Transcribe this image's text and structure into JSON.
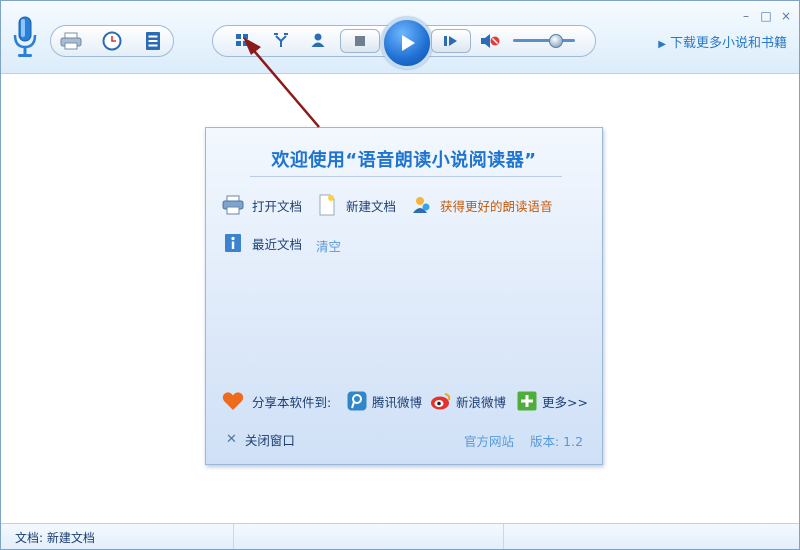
{
  "toolbar": {
    "download_label": "下载更多小说和书籍",
    "icons": [
      "microphone-icon",
      "printer-icon",
      "clock-icon",
      "document-list-icon",
      "grid-icon",
      "repeat-icon",
      "voice-person-icon",
      "stop-icon",
      "play-icon",
      "next-icon",
      "mute-icon"
    ],
    "volume": 0.75
  },
  "window_controls": {
    "minimize": "–",
    "maximize": "□",
    "close": "×"
  },
  "panel": {
    "title": "欢迎使用“语音朗读小说阅读器”",
    "open_doc": "打开文档",
    "new_doc": "新建文档",
    "get_voice": "获得更好的朗读语音",
    "recent_docs": "最近文档",
    "clear": "清空",
    "share_label": "分享本软件到:",
    "tencent_weibo": "腾讯微博",
    "sina_weibo": "新浪微博",
    "more": "更多>>",
    "close_window": "关闭窗口",
    "official_site": "官方网站",
    "version": "版本: 1.2"
  },
  "status": {
    "document": "文档: 新建文档"
  },
  "colors": {
    "accent": "#1f74cf",
    "orange_link": "#c45a0c",
    "arrow": "#8b1a1a"
  }
}
